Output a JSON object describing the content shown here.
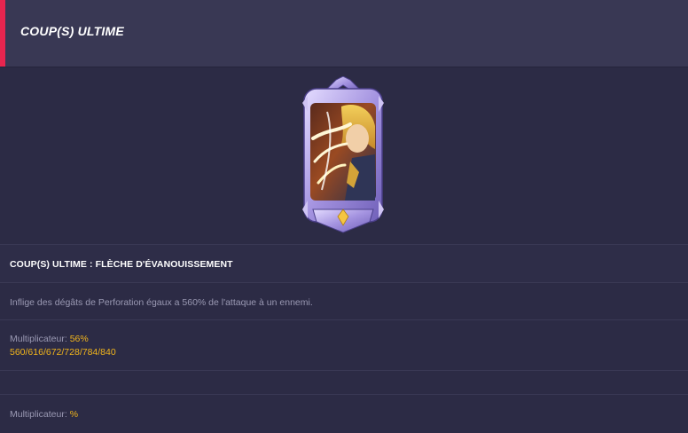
{
  "header": {
    "title": "COUP(S) ULTIME"
  },
  "skill": {
    "name": "COUP(S) ULTIME : FLÈCHE D'ÉVANOUISSEMENT",
    "description": "Inflige des dégâts de Perforation égaux a 560% de l'attaque à un ennemi.",
    "multiplier_label": "Multiplicateur:",
    "multiplier_value": "56%",
    "multiplier_levels": "560/616/672/728/784/840",
    "multiplier2_label": "Multiplicateur:",
    "multiplier2_value": "%"
  },
  "colors": {
    "accent": "#e8254f",
    "gold": "#f0b41c",
    "background": "#2c2b45",
    "header": "#393854"
  },
  "icons": {
    "card": "skill-card-icon"
  }
}
